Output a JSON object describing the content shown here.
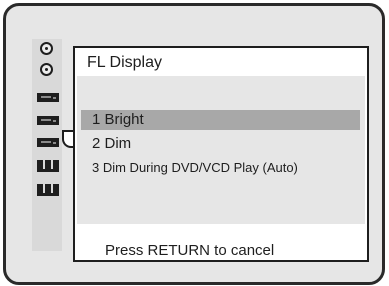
{
  "menu": {
    "title": "FL Display",
    "options": [
      {
        "label": "1 Bright",
        "selected": true
      },
      {
        "label": "2 Dim",
        "selected": false
      },
      {
        "label": "3 Dim During DVD/VCD Play (Auto)",
        "selected": false
      }
    ],
    "footer_hint": "Press RETURN to cancel"
  },
  "sidebar": {
    "icons": [
      {
        "name": "disc-icon"
      },
      {
        "name": "disc-icon"
      },
      {
        "name": "deck-icon"
      },
      {
        "name": "deck-icon"
      },
      {
        "name": "deck-icon",
        "active": true
      },
      {
        "name": "speakers-icon"
      },
      {
        "name": "speakers-icon"
      }
    ]
  },
  "colors": {
    "background": "#e6e6e6",
    "panel": "#ffffff",
    "highlight": "#a8a8a8",
    "ink": "#1e1e1e"
  }
}
